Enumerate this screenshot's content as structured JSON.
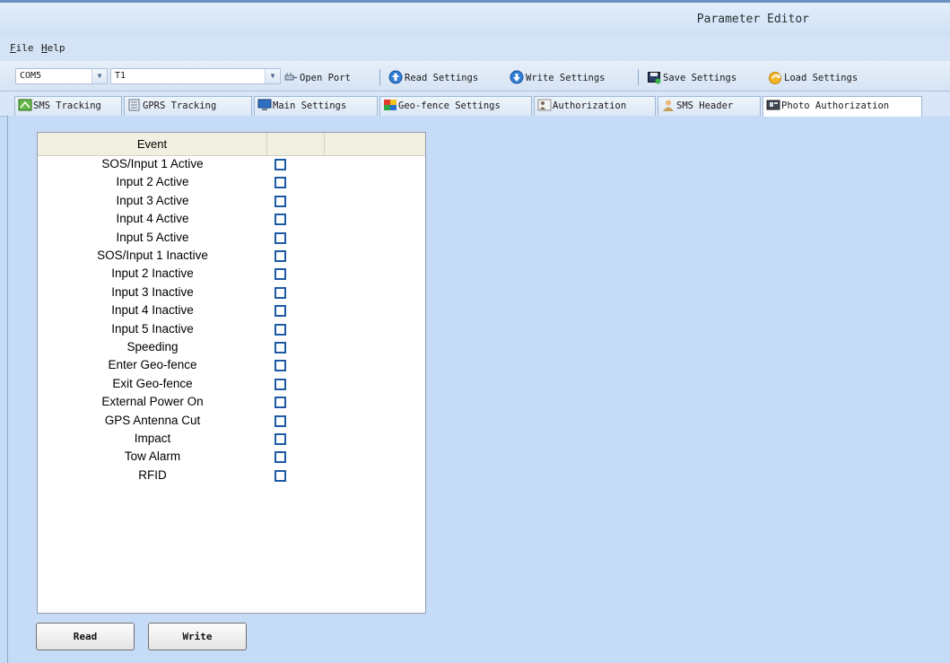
{
  "window": {
    "title": "Parameter Editor"
  },
  "menu": [
    {
      "label": "File",
      "accel": "F",
      "rest": "ile"
    },
    {
      "label": "Help",
      "accel": "H",
      "rest": "elp"
    }
  ],
  "toolbar": {
    "port_value": "COM5",
    "device_value": "T1",
    "open_port": "Open Port",
    "read_settings": "Read Settings",
    "write_settings": "Write Settings",
    "save_settings": "Save Settings",
    "load_settings": "Load Settings"
  },
  "tabs": [
    {
      "label": "SMS Tracking",
      "icon": "sms-tracking-icon"
    },
    {
      "label": "GPRS Tracking",
      "icon": "gprs-tracking-icon"
    },
    {
      "label": "Main Settings",
      "icon": "monitor-icon"
    },
    {
      "label": "Geo-fence Settings",
      "icon": "geofence-icon"
    },
    {
      "label": "Authorization",
      "icon": "authorization-icon"
    },
    {
      "label": "SMS Header",
      "icon": "person-icon"
    },
    {
      "label": "Photo Authorization",
      "icon": "photo-icon",
      "active": true
    }
  ],
  "table": {
    "columns": [
      "Event",
      "",
      ""
    ],
    "rows": [
      {
        "event": "SOS/Input 1 Active",
        "checked": false
      },
      {
        "event": "Input 2 Active",
        "checked": false
      },
      {
        "event": "Input 3 Active",
        "checked": false
      },
      {
        "event": "Input 4 Active",
        "checked": false
      },
      {
        "event": "Input 5 Active",
        "checked": false
      },
      {
        "event": "SOS/Input 1 Inactive",
        "checked": false
      },
      {
        "event": "Input 2 Inactive",
        "checked": false
      },
      {
        "event": "Input 3 Inactive",
        "checked": false
      },
      {
        "event": "Input 4 Inactive",
        "checked": false
      },
      {
        "event": "Input 5 Inactive",
        "checked": false
      },
      {
        "event": "Speeding",
        "checked": false
      },
      {
        "event": "Enter Geo-fence",
        "checked": false
      },
      {
        "event": "Exit Geo-fence",
        "checked": false
      },
      {
        "event": "External Power On",
        "checked": false
      },
      {
        "event": "GPS Antenna Cut",
        "checked": false
      },
      {
        "event": "Impact",
        "checked": false
      },
      {
        "event": "Tow Alarm",
        "checked": false
      },
      {
        "event": "RFID",
        "checked": false
      }
    ]
  },
  "buttons": {
    "read": "Read",
    "write": "Write"
  },
  "colors": {
    "background": "#c6dcf6",
    "checkbox_border": "#1c5aa6"
  }
}
